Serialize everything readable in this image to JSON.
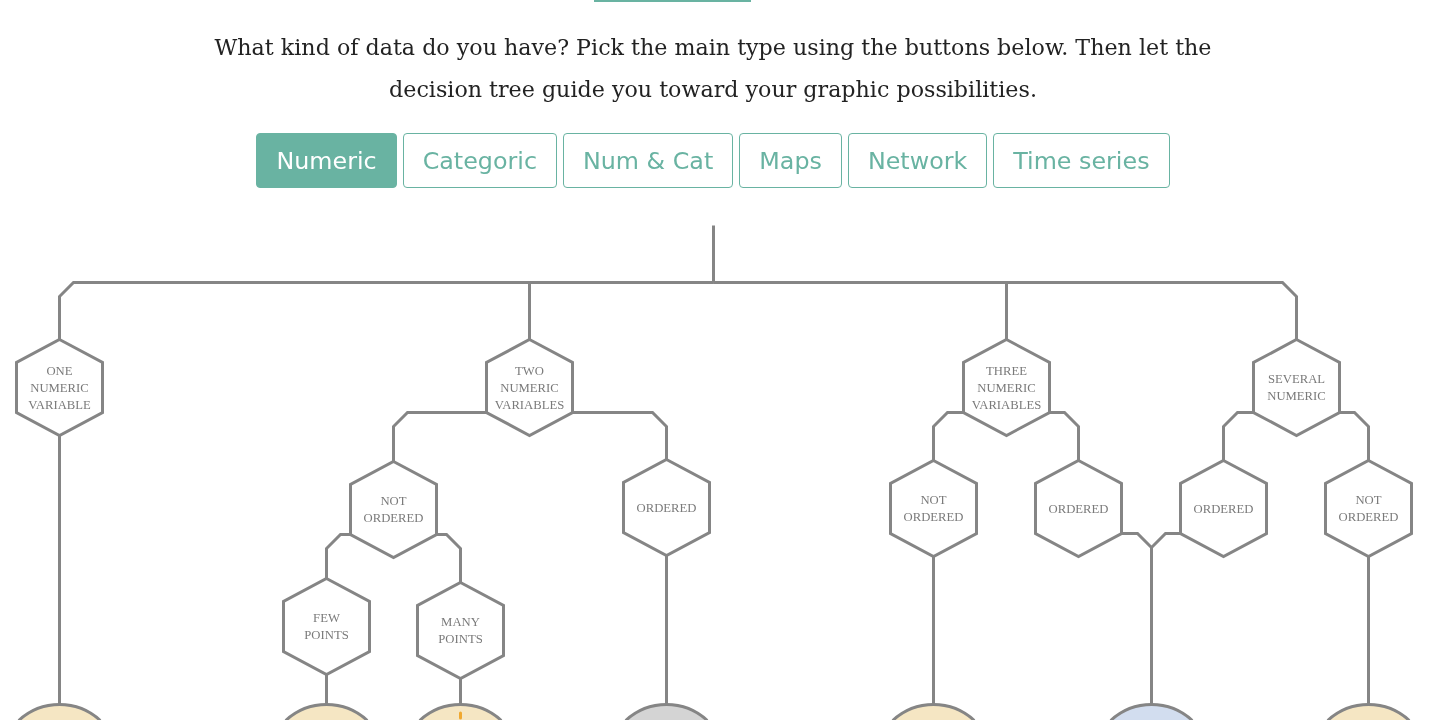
{
  "intro": {
    "text": "What kind of data do you have? Pick the main type using the buttons below. Then let the decision tree guide you toward your graphic possibilities."
  },
  "type_buttons": [
    {
      "label": "Numeric",
      "selected": true
    },
    {
      "label": "Categoric",
      "selected": false
    },
    {
      "label": "Num & Cat",
      "selected": false
    },
    {
      "label": "Maps",
      "selected": false
    },
    {
      "label": "Network",
      "selected": false
    },
    {
      "label": "Time series",
      "selected": false
    }
  ],
  "decision_tree": {
    "nodes": [
      {
        "label": "ONE NUMERIC VARIABLE",
        "outcome": {
          "color": "#f5e6c3",
          "icon": false
        }
      },
      {
        "label": "TWO NUMERIC VARIABLES",
        "children": [
          {
            "label": "NOT ORDERED",
            "children": [
              {
                "label": "FEW POINTS",
                "outcome": {
                  "color": "#f5e6c3",
                  "icon": false
                }
              },
              {
                "label": "MANY POINTS",
                "outcome": {
                  "color": "#f5e6c3",
                  "icon": true
                }
              }
            ]
          },
          {
            "label": "ORDERED",
            "outcome": {
              "color": "#d4d4d4",
              "icon": false
            }
          }
        ]
      },
      {
        "label": "THREE NUMERIC VARIABLES",
        "children": [
          {
            "label": "NOT ORDERED",
            "outcome": {
              "color": "#f5e6c3",
              "icon": false
            }
          },
          {
            "label": "ORDERED",
            "outcome": {
              "color": "#d2ddef",
              "icon": false
            }
          }
        ]
      },
      {
        "label": "SEVERAL NUMERIC",
        "children": [
          {
            "label": "ORDERED",
            "joins_previous": true
          },
          {
            "label": "NOT ORDERED",
            "outcome": {
              "color": "#f5e6c3",
              "icon": false
            }
          }
        ]
      }
    ]
  }
}
